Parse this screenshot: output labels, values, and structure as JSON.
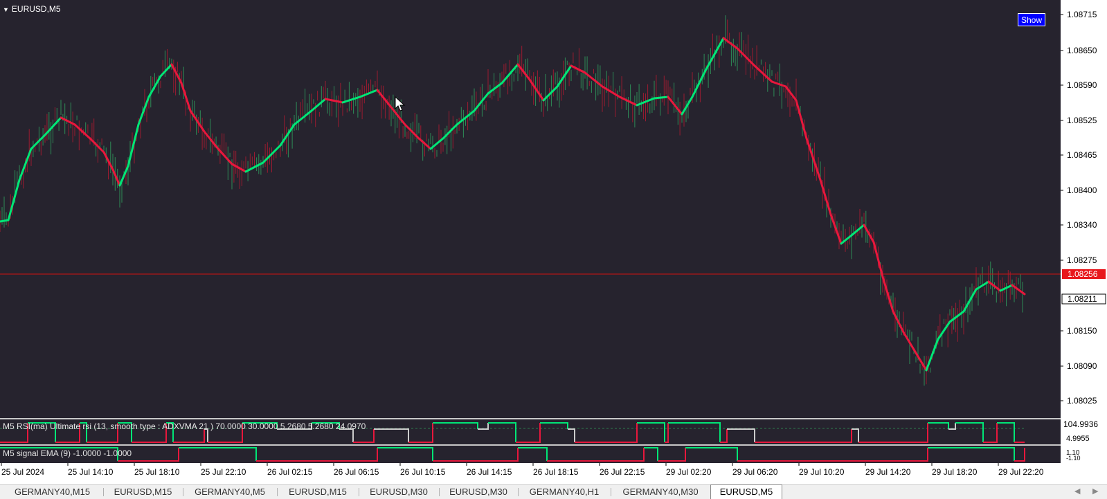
{
  "chart": {
    "symbol_title": "EURUSD,M5",
    "show_button": "Show",
    "price_labels": [
      "1.08715",
      "1.08650",
      "1.08590",
      "1.08525",
      "1.08465",
      "1.08400",
      "1.08340",
      "1.08275",
      "1.08211",
      "1.08150",
      "1.08090",
      "1.08025"
    ],
    "current_price_label": "1.08256",
    "bid_label": "1.08211",
    "time_labels": [
      "25 Jul 2024",
      "25 Jul 14:10",
      "25 Jul 18:10",
      "25 Jul 22:10",
      "26 Jul 02:15",
      "26 Jul 06:15",
      "26 Jul 10:15",
      "26 Jul 14:15",
      "26 Jul 18:15",
      "26 Jul 22:15",
      "29 Jul 02:20",
      "29 Jul 06:20",
      "29 Jul 10:20",
      "29 Jul 14:20",
      "29 Jul 18:20",
      "29 Jul 22:20"
    ],
    "colors": {
      "background": "#26232e",
      "ma_up": "#00e676",
      "ma_down": "#e8173c",
      "price_line": "#d11010",
      "candle_up": "#2e8b57",
      "candle_down": "#9b1b30"
    }
  },
  "indicator_rsi": {
    "title": "M5 RSI(ma) Ultimate rsi (13, smooth type : ADXVMA  21 ) 70.0000 30.0000 5.2680 5.2680 24.0970",
    "scale_label": "104.9936",
    "scale_label_2": "4.9955"
  },
  "indicator_ema": {
    "title": "M5 signal EMA (9) -1.0000 -1.0000",
    "scale_label": "1.10",
    "scale_label_2": "-1.10"
  },
  "tabs": [
    {
      "label": "GERMANY40,M15"
    },
    {
      "label": "EURUSD,M15"
    },
    {
      "label": "GERMANY40,M5"
    },
    {
      "label": "EURUSD,M15"
    },
    {
      "label": "EURUSD,M30"
    },
    {
      "label": "EURUSD,M30"
    },
    {
      "label": "GERMANY40,H1"
    },
    {
      "label": "GERMANY40,M30"
    },
    {
      "label": "EURUSD,M5"
    }
  ],
  "active_tab": 8
}
